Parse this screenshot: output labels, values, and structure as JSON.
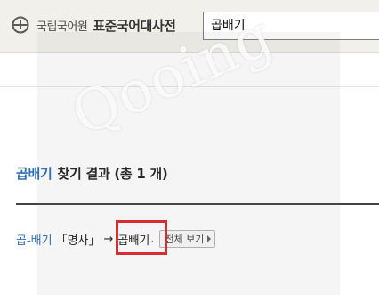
{
  "header": {
    "org_name": "국립국어원",
    "dictionary_title": "표준국어대사전",
    "search_value": "곱배기"
  },
  "results": {
    "term": "곱배기",
    "summary": "찾기 결과 (총 1 개)"
  },
  "entry": {
    "headword": "곱-배기",
    "part_of_speech": "「명사」",
    "arrow": "→",
    "target": "곱빼기",
    "end_punct": ".",
    "view_all_label": "전체 보기"
  },
  "watermark": {
    "text": "Qooing"
  },
  "colors": {
    "accent_blue": "#2f6fb4",
    "highlight_red": "#e0262e",
    "header_bg": "#f1f0eb"
  }
}
